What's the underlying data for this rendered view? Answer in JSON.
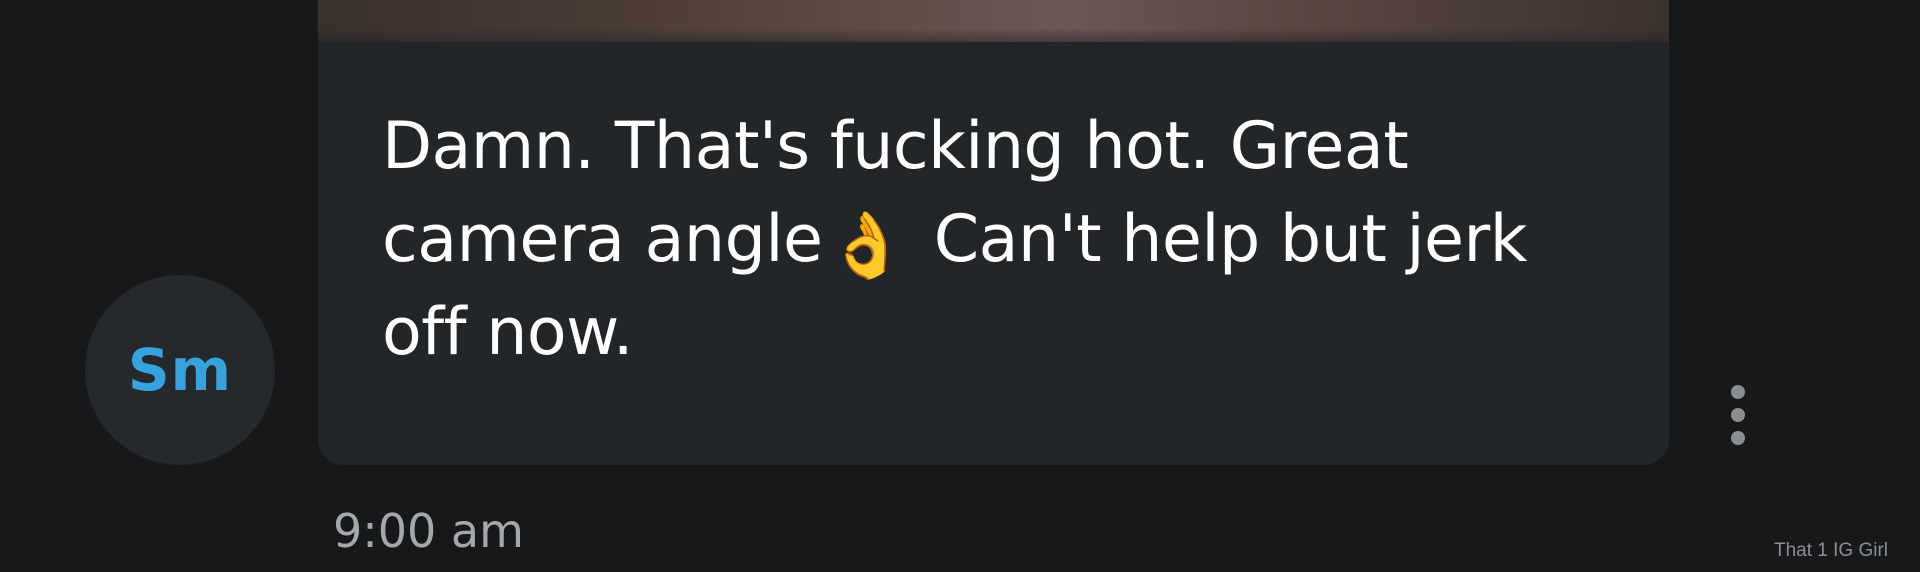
{
  "message": {
    "sender_initials": "Sm",
    "text_part1": "Damn. That's fucking hot. Great camera angle",
    "emoji": "👌",
    "emoji_name": "ok-hand-emoji",
    "text_part2": "Can't help but jerk off now.",
    "timestamp": "9:00 am"
  },
  "watermark": "That 1 IG Girl",
  "icons": {
    "more_menu": "vertical-ellipsis-icon"
  },
  "colors": {
    "background": "#171819",
    "bubble": "#232628",
    "avatar_bg": "#25292c",
    "initials": "#37a3de",
    "text": "#ffffff",
    "timestamp": "#a4a8ab"
  }
}
